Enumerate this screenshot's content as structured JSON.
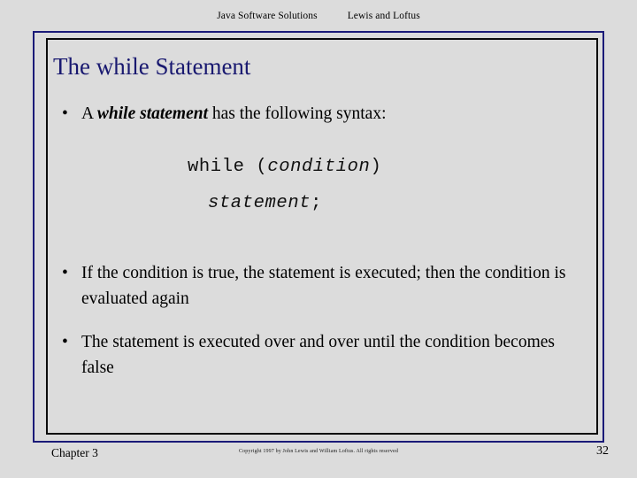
{
  "page": {
    "background_color": "#dcdcdc",
    "title_color": "#191970",
    "frame_outer_color": "#1a1a78",
    "frame_inner_color": "#0b0b0b"
  },
  "header": {
    "book_title": "Java Software Solutions",
    "authors": "Lewis and Loftus"
  },
  "slide": {
    "title": "The while Statement",
    "bullet_marker": "•",
    "bullets": [
      {
        "lead": "A ",
        "emphasis": "while statement",
        "tail": " has the following syntax:"
      },
      {
        "text": "If the condition is true, the statement is executed;  then the condition is evaluated again"
      },
      {
        "text": "The statement is executed over and over until the condition becomes false"
      }
    ],
    "code": {
      "line1_keyword": "while",
      "line1_open_paren": " (",
      "line1_placeholder": "condition",
      "line1_close_paren": ")",
      "line2_placeholder": "statement",
      "line2_terminator": ";"
    }
  },
  "footer": {
    "chapter": "Chapter 3",
    "copyright": "Copyright 1997 by John Lewis and William Loftus.  All rights reserved",
    "page_number": "32"
  }
}
